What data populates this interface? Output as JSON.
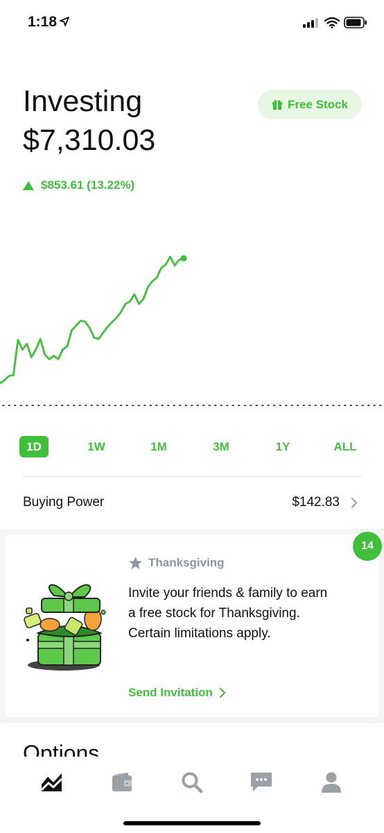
{
  "status_bar": {
    "time": "1:18",
    "icons": [
      "location-arrow-icon",
      "signal-icon",
      "wifi-icon",
      "battery-icon"
    ]
  },
  "header": {
    "title": "Investing",
    "balance": "$7,310.03",
    "free_stock_label": "Free Stock",
    "free_stock_icon": "gift-icon",
    "change_text": "$853.61 (13.22%)",
    "change_icon": "up-triangle-icon"
  },
  "colors": {
    "accent": "#3fbf3a",
    "accent_light": "#e8f7e3",
    "text": "#111111",
    "muted": "#8e949a",
    "section_bg": "#f3f4f6"
  },
  "chart_data": {
    "type": "line",
    "title": "",
    "xlabel": "",
    "ylabel": "",
    "y": [
      7050,
      7056,
      7065,
      7067,
      7140,
      7120,
      7132,
      7104,
      7120,
      7142,
      7110,
      7100,
      7107,
      7100,
      7120,
      7127,
      7160,
      7170,
      7180,
      7178,
      7165,
      7145,
      7142,
      7155,
      7167,
      7177,
      7186,
      7198,
      7215,
      7220,
      7235,
      7215,
      7225,
      7250,
      7262,
      7270,
      7290,
      7297,
      7313,
      7295,
      7307,
      7310.03
    ],
    "baseline": 6456.42,
    "grid": false,
    "legend": "none"
  },
  "time_ranges": {
    "items": [
      "1D",
      "1W",
      "1M",
      "3M",
      "1Y",
      "ALL"
    ],
    "selected": "1D"
  },
  "buying_power": {
    "label": "Buying Power",
    "value": "$142.83"
  },
  "promo_card": {
    "badge": "14",
    "tag": "Thanksgiving",
    "tag_icon": "star-icon",
    "body_lines": [
      "Invite your friends & family to earn",
      "a free stock for Thanksgiving.",
      "Certain limitations apply."
    ],
    "link_label": "Send Invitation",
    "illustration": "gift-box-illustration"
  },
  "options_section": {
    "heading": "Options"
  },
  "tab_bar": {
    "items": [
      "portfolio-tab",
      "wallet-tab",
      "search-tab",
      "messages-tab",
      "account-tab"
    ],
    "selected": "portfolio-tab"
  }
}
